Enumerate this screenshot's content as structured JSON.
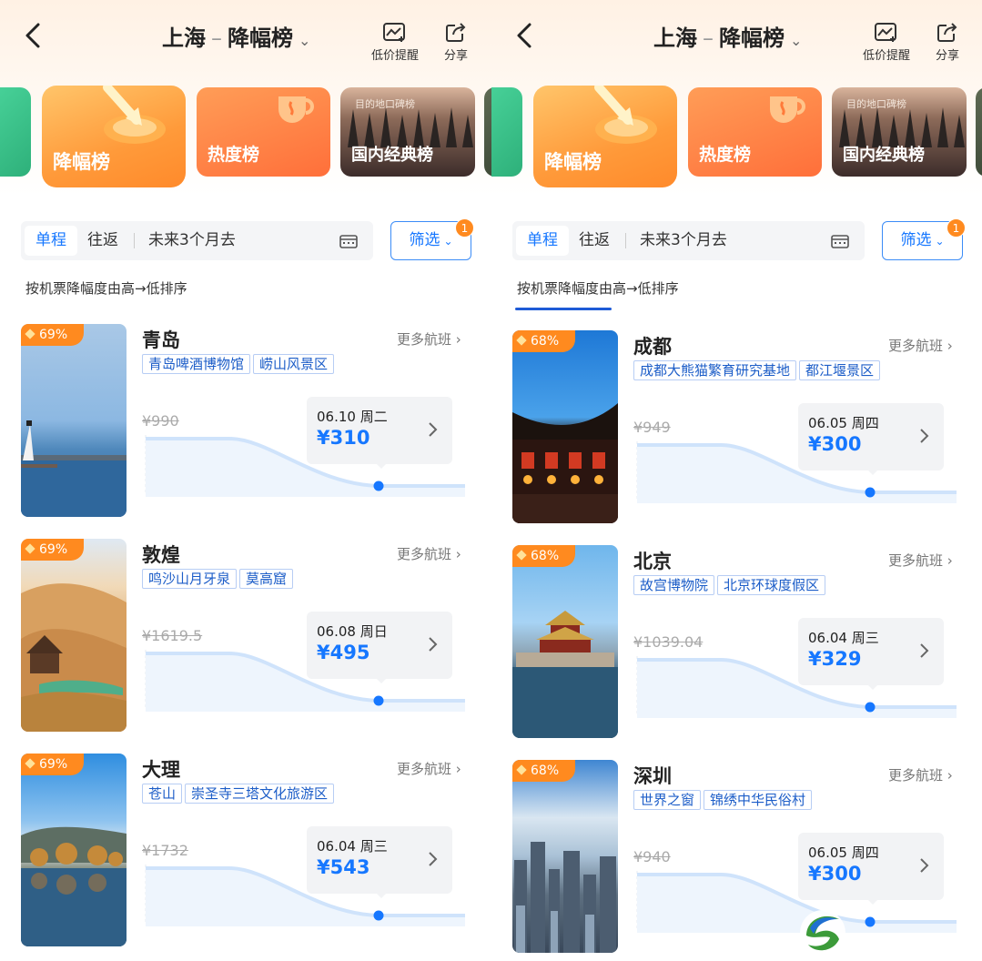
{
  "panels": [
    {
      "header": {
        "from": "上海",
        "sep": "–",
        "list": "降幅榜",
        "alert_label": "低价提醒",
        "share_label": "分享"
      },
      "banners": {
        "drop": "降幅榜",
        "hot": "热度榜",
        "domestic": "国内经典榜",
        "domestic_tag": "目的地口碑榜"
      },
      "filter": {
        "oneway": "单程",
        "roundtrip": "往返",
        "dates": "未来3个月去",
        "screen": "筛选",
        "badge": "1"
      },
      "sort_note": "按机票降幅度由高→低排序",
      "items": [
        {
          "pct": "69%",
          "city": "青岛",
          "more": "更多航班",
          "tags": [
            "青岛啤酒博物馆",
            "崂山风景区"
          ],
          "orig": "¥990",
          "date": "06.10 周二",
          "price": "¥310"
        },
        {
          "pct": "69%",
          "city": "敦煌",
          "more": "更多航班",
          "tags": [
            "鸣沙山月牙泉",
            "莫高窟"
          ],
          "orig": "¥1619.5",
          "date": "06.08 周日",
          "price": "¥495"
        },
        {
          "pct": "69%",
          "city": "大理",
          "more": "更多航班",
          "tags": [
            "苍山",
            "崇圣寺三塔文化旅游区"
          ],
          "orig": "¥1732",
          "date": "06.04 周三",
          "price": "¥543"
        }
      ]
    },
    {
      "header": {
        "from": "上海",
        "sep": "–",
        "list": "降幅榜",
        "alert_label": "低价提醒",
        "share_label": "分享"
      },
      "banners": {
        "drop": "降幅榜",
        "hot": "热度榜",
        "domestic": "国内经典榜",
        "domestic_tag": "目的地口碑榜"
      },
      "filter": {
        "oneway": "单程",
        "roundtrip": "往返",
        "dates": "未来3个月去",
        "screen": "筛选",
        "badge": "1"
      },
      "sort_note": "按机票降幅度由高→低排序",
      "items": [
        {
          "pct": "68%",
          "city": "成都",
          "more": "更多航班",
          "tags": [
            "成都大熊猫繁育研究基地",
            "都江堰景区"
          ],
          "orig": "¥949",
          "date": "06.05 周四",
          "price": "¥300"
        },
        {
          "pct": "68%",
          "city": "北京",
          "more": "更多航班",
          "tags": [
            "故宫博物院",
            "北京环球度假区"
          ],
          "orig": "¥1039.04",
          "date": "06.04 周三",
          "price": "¥329"
        },
        {
          "pct": "68%",
          "city": "深圳",
          "more": "更多航班",
          "tags": [
            "世界之窗",
            "锦绣中华民俗村"
          ],
          "orig": "¥940",
          "date": "06.05 周四",
          "price": "¥300"
        }
      ]
    }
  ],
  "colors": {
    "accent": "#1677ff",
    "badge": "#ff8a1f",
    "tag_border": "#b7cdf4"
  },
  "icons": [
    "back-arrow-icon",
    "chart-alert-icon",
    "share-icon",
    "calendar-icon",
    "chevron-down-icon",
    "chevron-right-icon",
    "app-logo-icon"
  ]
}
